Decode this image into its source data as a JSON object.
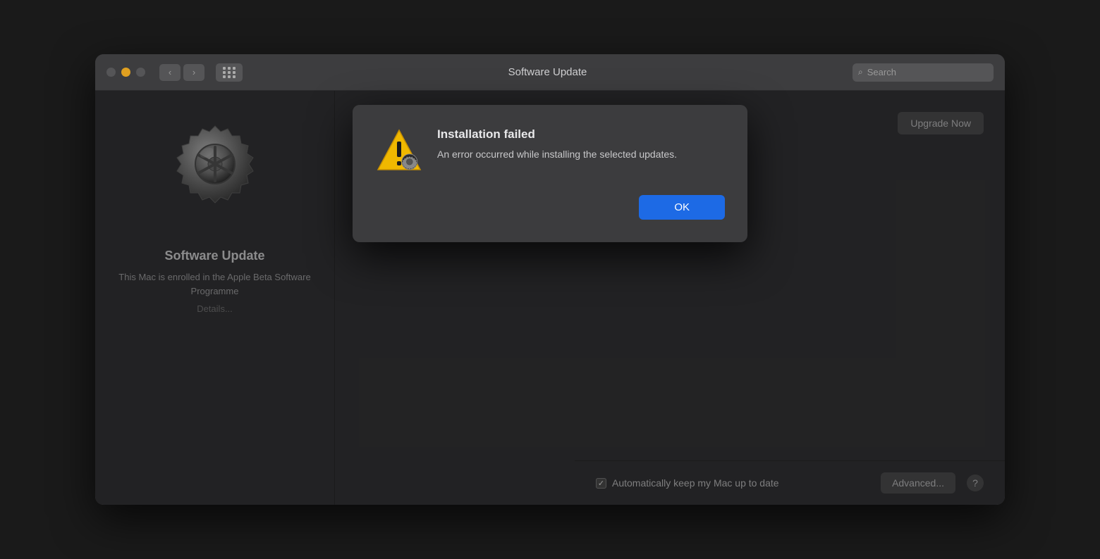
{
  "window": {
    "title": "Software Update"
  },
  "titlebar": {
    "back_label": "‹",
    "forward_label": "›",
    "search_placeholder": "Search"
  },
  "sidebar": {
    "icon_label": "gear-icon",
    "title": "Software Update",
    "subtitle": "This Mac is enrolled in the\nApple Beta Software\nProgramme",
    "details_link": "Details..."
  },
  "right_panel": {
    "upgrade_button_label": "Upgrade Now"
  },
  "modal": {
    "title": "Installation failed",
    "body": "An error occurred while installing the\nselected updates.",
    "ok_button_label": "OK"
  },
  "bottom_bar": {
    "checkbox_label": "Automatically keep my Mac up to date",
    "advanced_button_label": "Advanced...",
    "help_button_label": "?"
  },
  "colors": {
    "accent_blue": "#1d6ae5",
    "window_bg": "#3a3a3c",
    "titlebar_bg": "#3d3d3f",
    "modal_bg": "#3c3c3e",
    "text_primary": "#e8e8ea",
    "text_secondary": "#b0b0b2",
    "text_muted": "#808082",
    "button_bg": "#555557"
  }
}
